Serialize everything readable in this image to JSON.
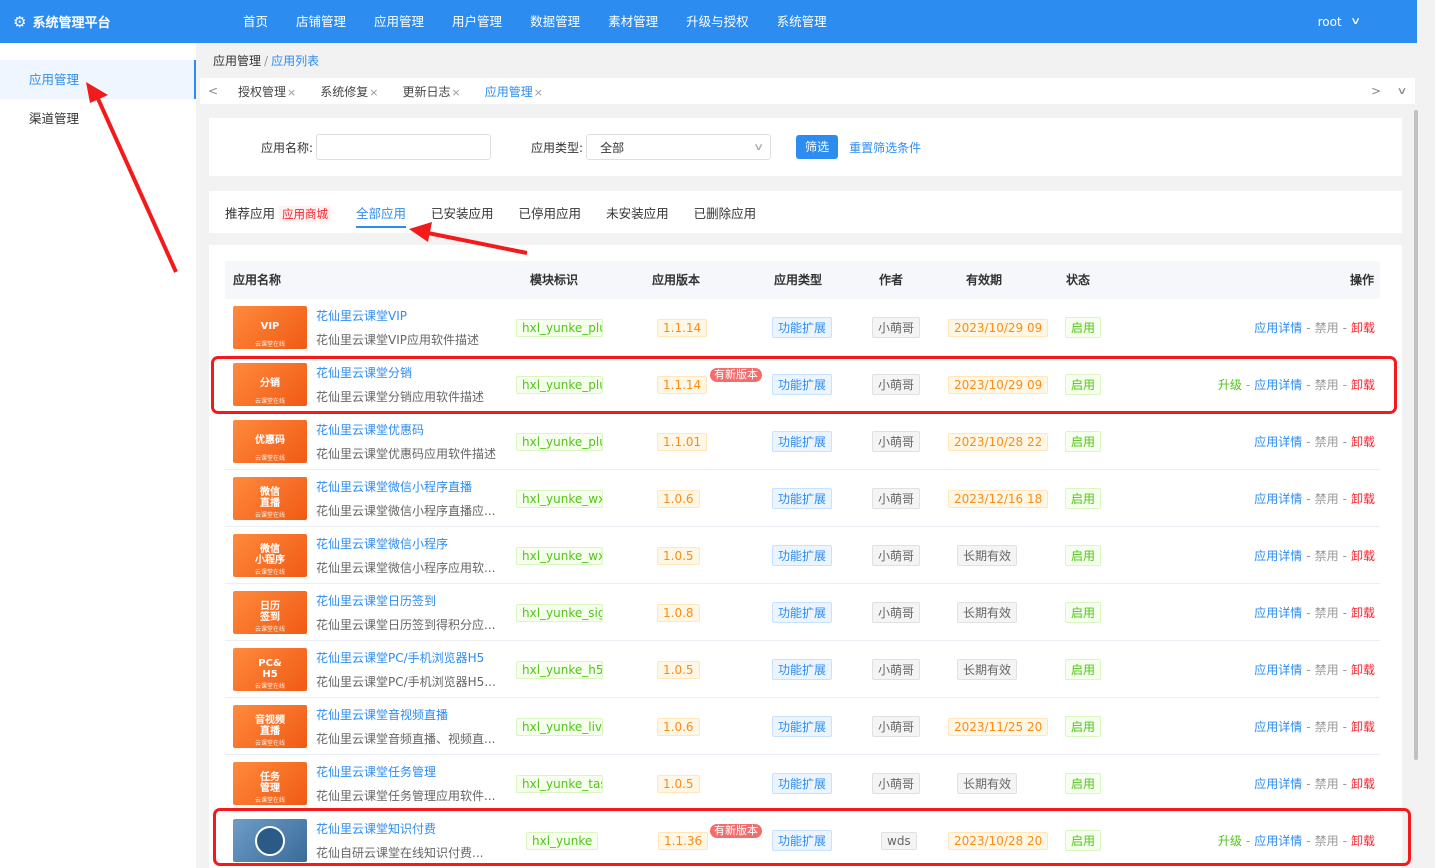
{
  "header": {
    "brand": "系统管理平台",
    "brand_icon": "gear-icon",
    "nav": [
      "首页",
      "店铺管理",
      "应用管理",
      "用户管理",
      "数据管理",
      "素材管理",
      "升级与授权",
      "系统管理"
    ],
    "user": "root",
    "accent": "#2d8cf0"
  },
  "sidebar": {
    "items": [
      "应用管理",
      "渠道管理"
    ]
  },
  "breadcrumb": {
    "parent": "应用管理",
    "sep": "/",
    "current": "应用列表"
  },
  "tabs": [
    {
      "label": "授权管理",
      "close": "×"
    },
    {
      "label": "系统修复",
      "close": "×"
    },
    {
      "label": "更新日志",
      "close": "×"
    },
    {
      "label": "应用管理",
      "close": "×"
    }
  ],
  "filter": {
    "name_label": "应用名称:",
    "name_value": "",
    "type_label": "应用类型:",
    "type_value": "全部",
    "submit": "筛选",
    "reset": "重置筛选条件"
  },
  "categories": {
    "recommend": "推荐应用",
    "store": "应用商城",
    "items": [
      "全部应用",
      "已安装应用",
      "已停用应用",
      "未安装应用",
      "已删除应用"
    ]
  },
  "table": {
    "headers": [
      "应用名称",
      "模块标识",
      "应用版本",
      "应用类型",
      "作者",
      "有效期",
      "状态",
      "操作"
    ],
    "new_badge": "有新版本",
    "ops": {
      "upgrade": "升级",
      "detail": "应用详情",
      "disable": "禁用",
      "uninstall": "卸载",
      "sep": "-"
    },
    "rows": [
      {
        "thumb": "VIP",
        "thumb_sub": "云课堂在线",
        "title": "花仙里云课堂VIP",
        "desc": "花仙里云课堂VIP应用软件描述",
        "module": "hxl_yunke_plug",
        "version": "1.1.14",
        "type": "功能扩展",
        "author": "小萌哥",
        "expiry": "2023/10/29 09",
        "status": "启用",
        "has_new": false
      },
      {
        "thumb": "分销",
        "thumb_sub": "云课堂在线",
        "title": "花仙里云课堂分销",
        "desc": "花仙里云课堂分销应用软件描述",
        "module": "hxl_yunke_plug",
        "version": "1.1.14",
        "type": "功能扩展",
        "author": "小萌哥",
        "expiry": "2023/10/29 09",
        "status": "启用",
        "has_new": true
      },
      {
        "thumb": "优惠码",
        "thumb_sub": "云课堂在线",
        "title": "花仙里云课堂优惠码",
        "desc": "花仙里云课堂优惠码应用软件描述",
        "module": "hxl_yunke_plug",
        "version": "1.1.01",
        "type": "功能扩展",
        "author": "小萌哥",
        "expiry": "2023/10/28 22",
        "status": "启用",
        "has_new": false
      },
      {
        "thumb": "微信 直播",
        "thumb_sub": "云课堂在线",
        "title": "花仙里云课堂微信小程序直播",
        "desc": "花仙里云课堂微信小程序直播应...",
        "module": "hxl_yunke_wxli",
        "version": "1.0.6",
        "type": "功能扩展",
        "author": "小萌哥",
        "expiry": "2023/12/16 18",
        "status": "启用",
        "has_new": false
      },
      {
        "thumb": "微信 小程序",
        "thumb_sub": "云课堂在线",
        "title": "花仙里云课堂微信小程序",
        "desc": "花仙里云课堂微信小程序应用软...",
        "module": "hxl_yunke_wxa",
        "version": "1.0.5",
        "type": "功能扩展",
        "author": "小萌哥",
        "expiry": "长期有效",
        "status": "启用",
        "has_new": false
      },
      {
        "thumb": "日历 签到",
        "thumb_sub": "云课堂在线",
        "title": "花仙里云课堂日历签到",
        "desc": "花仙里云课堂日历签到得积分应...",
        "module": "hxl_yunke_sign",
        "version": "1.0.8",
        "type": "功能扩展",
        "author": "小萌哥",
        "expiry": "长期有效",
        "status": "启用",
        "has_new": false
      },
      {
        "thumb": "PC& H5",
        "thumb_sub": "云课堂在线",
        "title": "花仙里云课堂PC/手机浏览器H5",
        "desc": "花仙里云课堂PC/手机浏览器H5...",
        "module": "hxl_yunke_h5",
        "version": "1.0.5",
        "type": "功能扩展",
        "author": "小萌哥",
        "expiry": "长期有效",
        "status": "启用",
        "has_new": false
      },
      {
        "thumb": "音视频 直播",
        "thumb_sub": "云课堂在线",
        "title": "花仙里云课堂音视频直播",
        "desc": "花仙里云课堂音频直播、视频直...",
        "module": "hxl_yunke_live",
        "version": "1.0.6",
        "type": "功能扩展",
        "author": "小萌哥",
        "expiry": "2023/11/25 20",
        "status": "启用",
        "has_new": false
      },
      {
        "thumb": "任务 管理",
        "thumb_sub": "云课堂在线",
        "title": "花仙里云课堂任务管理",
        "desc": "花仙里云课堂任务管理应用软件...",
        "module": "hxl_yunke_task",
        "version": "1.0.5",
        "type": "功能扩展",
        "author": "小萌哥",
        "expiry": "长期有效",
        "status": "启用",
        "has_new": false
      },
      {
        "thumb": "",
        "thumb_sub": "",
        "title": "花仙里云课堂知识付费",
        "desc": "花仙自研云课堂在线知识付费...",
        "module": "hxl_yunke",
        "version": "1.1.36",
        "type": "功能扩展",
        "author": "wds",
        "expiry": "2023/10/28 20",
        "status": "启用",
        "has_new": true
      }
    ]
  }
}
